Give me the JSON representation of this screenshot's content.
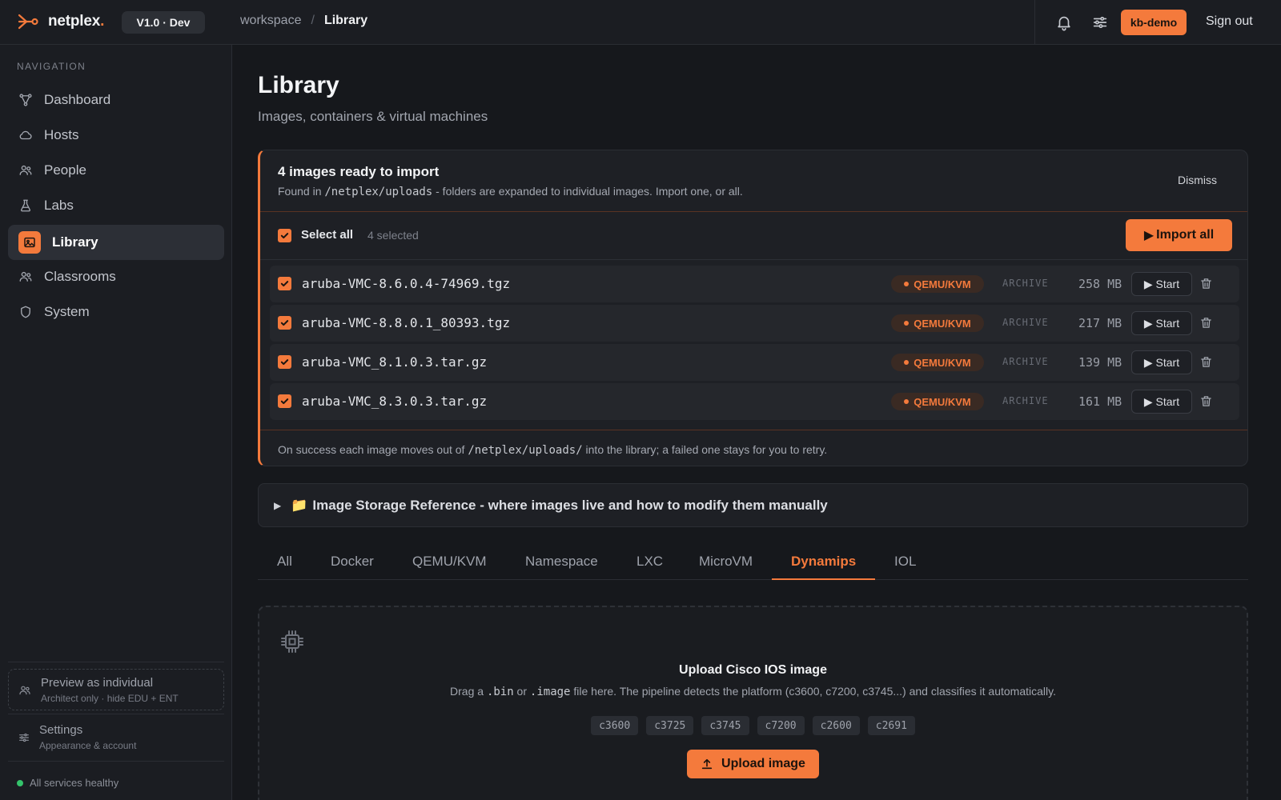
{
  "brand": {
    "name": "netplex",
    "dot": ".",
    "version": "V1.0 · Dev",
    "accent": "#f47a3c"
  },
  "breadcrumb": {
    "parent": "workspace",
    "separator": "/",
    "current": "Library"
  },
  "header": {
    "user": "kb-demo",
    "sign_out": "Sign out",
    "icons": [
      "bell-icon",
      "sliders-icon"
    ]
  },
  "sidebar": {
    "heading": "NAVIGATION",
    "items": [
      {
        "label": "Dashboard",
        "icon": "topology-icon"
      },
      {
        "label": "Hosts",
        "icon": "cloud-icon"
      },
      {
        "label": "People",
        "icon": "people-icon"
      },
      {
        "label": "Labs",
        "icon": "flask-icon"
      },
      {
        "label": "Library",
        "icon": "image-icon",
        "active": true
      },
      {
        "label": "Classrooms",
        "icon": "people-icon"
      },
      {
        "label": "System",
        "icon": "shield-icon"
      }
    ],
    "preview": {
      "title": "Preview as individual",
      "subtitle": "Architect only · hide EDU + ENT"
    },
    "settings": {
      "title": "Settings",
      "subtitle": "Appearance & account"
    },
    "status": "All services healthy"
  },
  "page": {
    "title": "Library",
    "subtitle": "Images, containers & virtual machines"
  },
  "import_panel": {
    "title": "4 images ready to import",
    "desc_before": "Found in ",
    "desc_path": "/netplex/uploads",
    "desc_after": " - folders are expanded to individual images. Import one, or all.",
    "dismiss": "Dismiss",
    "select_all": "Select all",
    "selected_count": "4 selected",
    "import_all": "Import all",
    "rows": [
      {
        "name": "aruba-VMC-8.6.0.4-74969.tgz",
        "type": "QEMU/KVM",
        "kind": "ARCHIVE",
        "size": "258 MB",
        "action": "Start"
      },
      {
        "name": "aruba-VMC-8.8.0.1_80393.tgz",
        "type": "QEMU/KVM",
        "kind": "ARCHIVE",
        "size": "217 MB",
        "action": "Start"
      },
      {
        "name": "aruba-VMC_8.1.0.3.tar.gz",
        "type": "QEMU/KVM",
        "kind": "ARCHIVE",
        "size": "139 MB",
        "action": "Start"
      },
      {
        "name": "aruba-VMC_8.3.0.3.tar.gz",
        "type": "QEMU/KVM",
        "kind": "ARCHIVE",
        "size": "161 MB",
        "action": "Start"
      }
    ],
    "footer_before": "On success each image moves out of ",
    "footer_path": "/netplex/uploads/",
    "footer_after": " into the library; a failed one stays for you to retry."
  },
  "storage_reference": {
    "caret": "▶",
    "emoji": "📁",
    "label": "Image Storage Reference - where images live and how to modify them manually"
  },
  "tabs": [
    "All",
    "Docker",
    "QEMU/KVM",
    "Namespace",
    "LXC",
    "MicroVM",
    "Dynamips",
    "IOL"
  ],
  "active_tab": "Dynamips",
  "upload": {
    "title": "Upload Cisco IOS image",
    "desc_1": "Drag a ",
    "ext_1": ".bin",
    "desc_2": " or ",
    "ext_2": ".image",
    "desc_3": " file here. The pipeline detects the platform (c3600, c7200, c3745...) and classifies it automatically.",
    "platforms": [
      "c3600",
      "c3725",
      "c3745",
      "c7200",
      "c2600",
      "c2691"
    ],
    "button": "Upload image"
  }
}
